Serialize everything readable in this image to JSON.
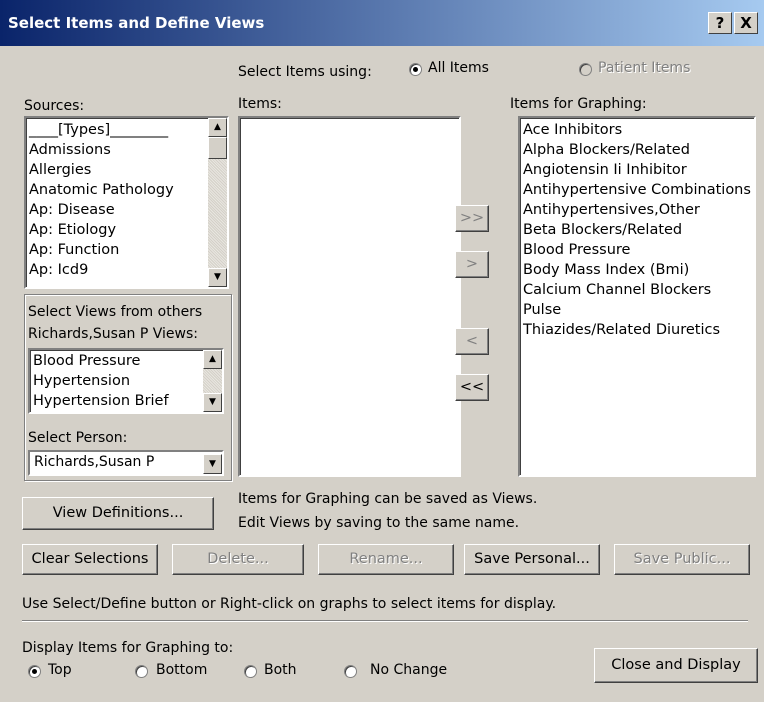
{
  "window": {
    "title": "Select Items and Define Views",
    "help": "?",
    "close": "X"
  },
  "select_using": {
    "label": "Select Items using:",
    "all_items": "All Items",
    "patient_items": "Patient Items",
    "selected": "All Items"
  },
  "sources": {
    "label": "Sources:",
    "items": [
      "____[Types]________",
      "Admissions",
      "Allergies",
      "Anatomic Pathology",
      "Ap: Disease",
      "Ap: Etiology",
      "Ap: Function",
      "Ap: Icd9"
    ]
  },
  "items": {
    "label": "Items:"
  },
  "graphing": {
    "label": "Items for Graphing:",
    "items": [
      "Ace Inhibitors",
      "Alpha Blockers/Related",
      "Angiotensin Ii Inhibitor",
      "Antihypertensive Combinations",
      "Antihypertensives,Other",
      "Beta Blockers/Related",
      "Blood Pressure",
      "Body Mass Index (Bmi)",
      "Calcium Channel Blockers",
      "Pulse",
      "Thiazides/Related Diuretics"
    ]
  },
  "transfer": {
    "add_all": ">>",
    "add": ">",
    "remove": "<",
    "remove_all": "<<"
  },
  "views": {
    "group_label": "Select Views from others",
    "person_views_label": "Richards,Susan P Views:",
    "items": [
      "Blood Pressure",
      "Hypertension",
      "Hypertension Brief"
    ],
    "select_person_label": "Select Person:",
    "person_value": "Richards,Susan P"
  },
  "info": {
    "line1": "Items for Graphing can be saved as Views.",
    "line2": "Edit Views by saving to the same name."
  },
  "buttons": {
    "view_definitions": "View Definitions...",
    "clear": "Clear Selections",
    "delete": "Delete...",
    "rename": "Rename...",
    "save_personal": "Save Personal...",
    "save_public": "Save Public...",
    "close_display": "Close and Display"
  },
  "hint": "Use Select/Define button or Right-click on graphs to select items for display.",
  "display_to": {
    "label": "Display Items for Graphing to:",
    "top": "Top",
    "bottom": "Bottom",
    "both": "Both",
    "no_change": "No Change",
    "selected": "Top"
  }
}
